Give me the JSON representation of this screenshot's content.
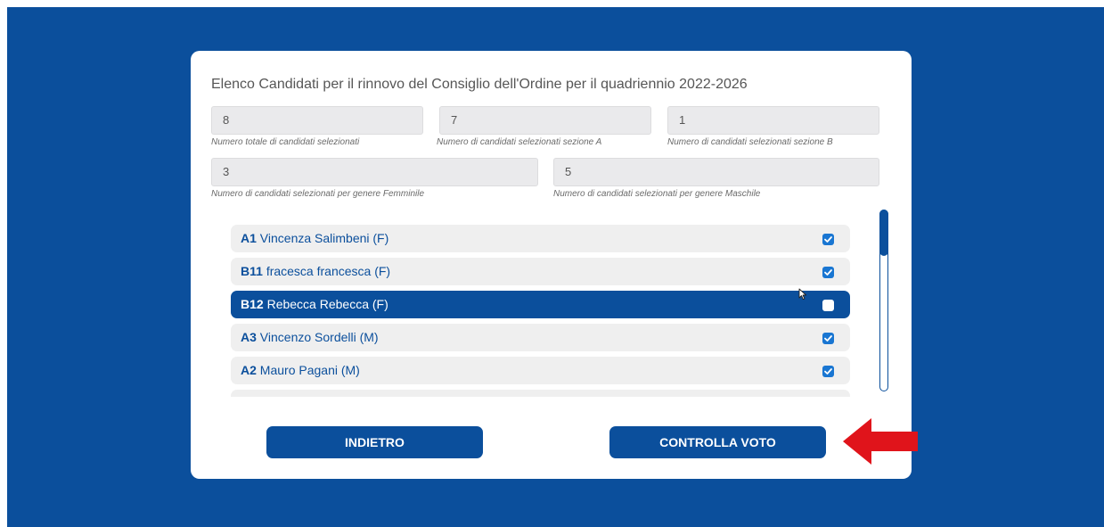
{
  "page_title": "Elenco Candidati per il rinnovo del Consiglio dell'Ordine per il quadriennio 2022-2026",
  "counters": {
    "total": {
      "value": "8",
      "label": "Numero totale di candidati selezionati"
    },
    "section_a": {
      "value": "7",
      "label": "Numero di candidati selezionati sezione A"
    },
    "section_b": {
      "value": "1",
      "label": "Numero di candidati selezionati sezione B"
    },
    "female": {
      "value": "3",
      "label": "Numero di candidati selezionati per genere Femminile"
    },
    "male": {
      "value": "5",
      "label": "Numero di candidati selezionati per genere Maschile"
    }
  },
  "candidates": [
    {
      "code": "A1",
      "name": "Vincenza Salimbeni (F)",
      "checked": true,
      "highlighted": false
    },
    {
      "code": "B11",
      "name": "fracesca francesca (F)",
      "checked": true,
      "highlighted": false
    },
    {
      "code": "B12",
      "name": "Rebecca Rebecca (F)",
      "checked": false,
      "highlighted": true
    },
    {
      "code": "A3",
      "name": "Vincenzo Sordelli (M)",
      "checked": true,
      "highlighted": false
    },
    {
      "code": "A2",
      "name": "Mauro Pagani (M)",
      "checked": true,
      "highlighted": false
    }
  ],
  "buttons": {
    "back": "INDIETRO",
    "check_vote": "CONTROLLA VOTO"
  },
  "colors": {
    "brand_blue": "#0b4f9c",
    "checkbox_blue": "#1976d2",
    "annotation_arrow": "#e0141b"
  },
  "icons": {
    "checkbox": "checkmark-icon",
    "annotation": "red-arrow-icon",
    "cursor": "mouse-pointer-icon"
  }
}
